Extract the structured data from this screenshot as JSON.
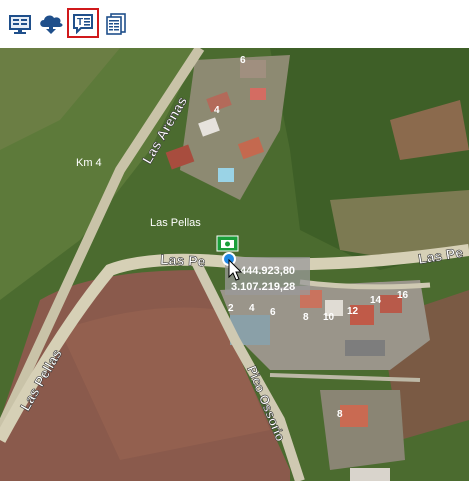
{
  "toolbar": {
    "buttons": [
      {
        "icon": "monitor-layers-icon",
        "active": false
      },
      {
        "icon": "cloud-download-icon",
        "active": false
      },
      {
        "icon": "text-comment-icon",
        "active": true
      },
      {
        "icon": "report-table-icon",
        "active": false
      }
    ],
    "active_border_color": "#d0191b",
    "icon_color": "#1f4f8b"
  },
  "map": {
    "road_labels": {
      "las_arenas": "Las Arenas",
      "las_pellas_left": "Las Pellas",
      "las_pellas_middle": "Las Pe",
      "las_pellas_right": "Las Pe",
      "pico_ossorio": "Pico Ossorio"
    },
    "place_labels": {
      "km4": "Km 4",
      "las_pellas_place": "Las Pellas"
    },
    "house_numbers": [
      "6",
      "4",
      "2",
      "4",
      "6",
      "8",
      "10",
      "12",
      "14",
      "16",
      "8"
    ],
    "coordinates": {
      "x": "444.923,80",
      "y": "3.107.219,28"
    },
    "marker_color": "#1a9e3a",
    "pin_color": "#1e88e5"
  }
}
